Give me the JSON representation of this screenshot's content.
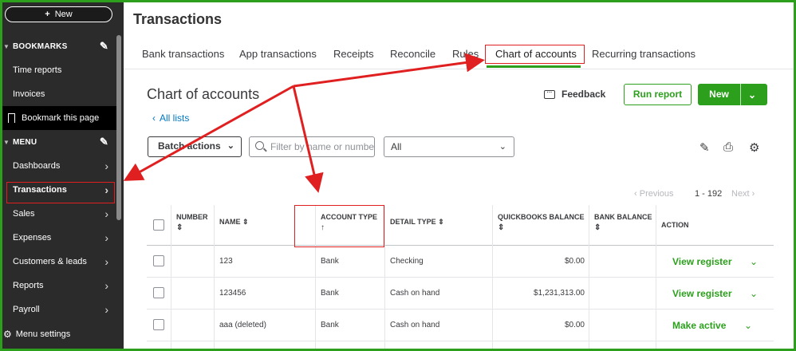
{
  "sidebar": {
    "new_button": "New",
    "bookmarks_header": "BOOKMARKS",
    "items": [
      {
        "label": "Time reports"
      },
      {
        "label": "Invoices"
      },
      {
        "label": "Bookmark this page"
      }
    ],
    "menu_header": "MENU",
    "menu_items": [
      {
        "label": "Dashboards"
      },
      {
        "label": "Transactions"
      },
      {
        "label": "Sales"
      },
      {
        "label": "Expenses"
      },
      {
        "label": "Customers & leads"
      },
      {
        "label": "Reports"
      },
      {
        "label": "Payroll"
      }
    ],
    "menu_settings": "Menu settings"
  },
  "header": {
    "title": "Transactions",
    "tabs": [
      {
        "label": "Bank transactions"
      },
      {
        "label": "App transactions"
      },
      {
        "label": "Receipts"
      },
      {
        "label": "Reconcile"
      },
      {
        "label": "Rules"
      },
      {
        "label": "Chart of accounts"
      },
      {
        "label": "Recurring transactions"
      }
    ],
    "active_tab": "Chart of accounts"
  },
  "page": {
    "title": "Chart of accounts",
    "back_link": "All lists",
    "feedback": "Feedback",
    "run_report": "Run report",
    "new_button": "New",
    "batch_actions": "Batch actions",
    "search_placeholder": "Filter by name or number",
    "filter_value": "All",
    "pager": {
      "previous": "Previous",
      "range": "1 - 192",
      "next": "Next"
    }
  },
  "table": {
    "columns": {
      "number": "NUMBER",
      "name": "NAME",
      "account_type": "ACCOUNT TYPE",
      "detail_type": "DETAIL TYPE",
      "qb_balance": "QUICKBOOKS BALANCE",
      "bank_balance": "BANK BALANCE",
      "action": "ACTION"
    },
    "rows": [
      {
        "number": "",
        "name": "123",
        "account_type": "Bank",
        "detail_type": "Checking",
        "qb_balance": "$0.00",
        "bank_balance": "",
        "action": "View register"
      },
      {
        "number": "",
        "name": "123456",
        "account_type": "Bank",
        "detail_type": "Cash on hand",
        "qb_balance": "$1,231,313.00",
        "bank_balance": "",
        "action": "View register"
      },
      {
        "number": "",
        "name": "aaa (deleted)",
        "account_type": "Bank",
        "detail_type": "Cash on hand",
        "qb_balance": "$0.00",
        "bank_balance": "",
        "action": "Make active"
      }
    ]
  },
  "colors": {
    "accent_green": "#2ca01c",
    "annotation_red": "#e02020",
    "link_blue": "#0077c5",
    "sidebar_bg": "#2b2b2b"
  }
}
